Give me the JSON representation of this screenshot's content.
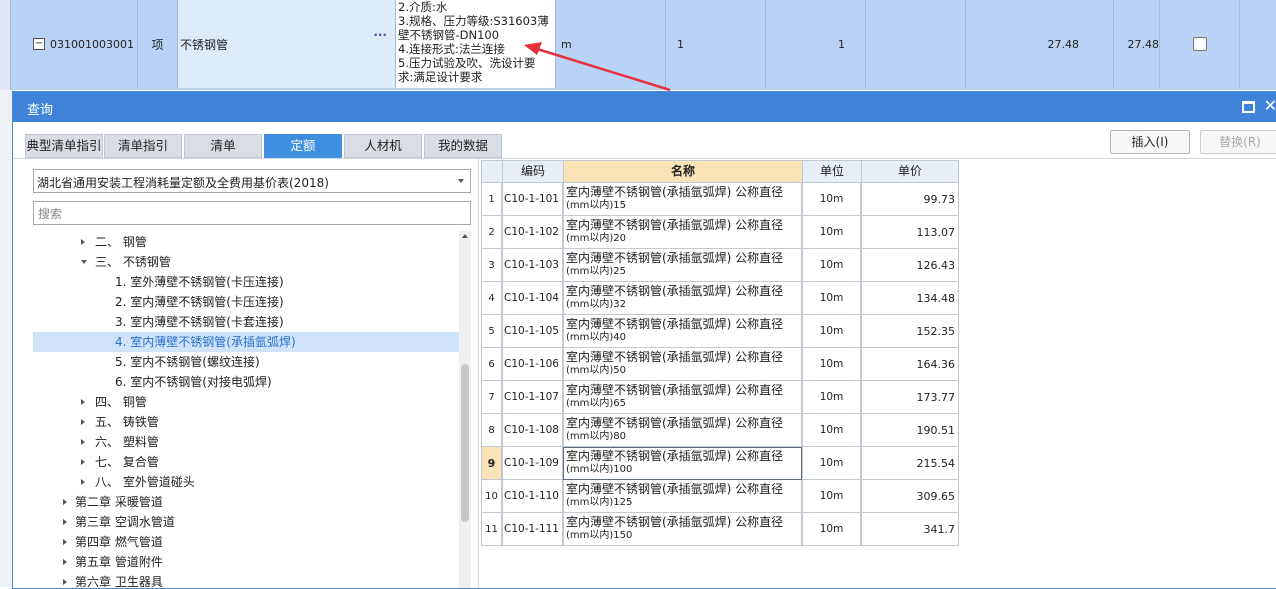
{
  "bg_row": {
    "expander": "−",
    "code": "031001003001",
    "type": "项",
    "name": "不锈钢管",
    "dots": "···",
    "desc_lines": [
      "2.介质:水",
      "3.规格、压力等级:S31603薄",
      "壁不锈钢管-DN100",
      "4.连接形式:法兰连接",
      "5.压力试验及吹、洗设计要",
      "求:满足设计要求"
    ],
    "unit": "m",
    "qty1": "1",
    "qty2": "1",
    "price1": "27.48",
    "price2": "27.48"
  },
  "dialog": {
    "title": "查询",
    "tabs": [
      "典型清单指引",
      "清单指引",
      "清单",
      "定额",
      "人材机",
      "我的数据"
    ],
    "active_tab": "定额",
    "insert_label": "插入(I)",
    "replace_label": "替换(R)",
    "library": "湖北省通用安装工程消耗量定额及全费用基价表(2018)",
    "search_placeholder": "搜索",
    "tree": [
      {
        "label": "二、 钢管",
        "level": 1,
        "expand": "collapsed"
      },
      {
        "label": "三、 不锈钢管",
        "level": 1,
        "expand": "expanded"
      },
      {
        "label": "1. 室外薄壁不锈钢管(卡压连接)",
        "level": 2,
        "expand": "none"
      },
      {
        "label": "2. 室内薄壁不锈钢管(卡压连接)",
        "level": 2,
        "expand": "none"
      },
      {
        "label": "3. 室内薄壁不锈钢管(卡套连接)",
        "level": 2,
        "expand": "none"
      },
      {
        "label": "4. 室内薄壁不锈钢管(承插氩弧焊)",
        "level": 2,
        "expand": "none",
        "selected": true
      },
      {
        "label": "5. 室内不锈钢管(螺纹连接)",
        "level": 2,
        "expand": "none"
      },
      {
        "label": "6. 室内不锈钢管(对接电弧焊)",
        "level": 2,
        "expand": "none"
      },
      {
        "label": "四、 铜管",
        "level": 1,
        "expand": "collapsed"
      },
      {
        "label": "五、 铸铁管",
        "level": 1,
        "expand": "collapsed"
      },
      {
        "label": "六、 塑料管",
        "level": 1,
        "expand": "collapsed"
      },
      {
        "label": "七、 复合管",
        "level": 1,
        "expand": "collapsed"
      },
      {
        "label": "八、 室外管道碰头",
        "level": 1,
        "expand": "collapsed"
      },
      {
        "label": "第二章 采暖管道",
        "level": 0,
        "expand": "collapsed"
      },
      {
        "label": "第三章 空调水管道",
        "level": 0,
        "expand": "collapsed"
      },
      {
        "label": "第四章 燃气管道",
        "level": 0,
        "expand": "collapsed"
      },
      {
        "label": "第五章 管道附件",
        "level": 0,
        "expand": "collapsed"
      },
      {
        "label": "第六章 卫生器具",
        "level": 0,
        "expand": "collapsed"
      }
    ],
    "table": {
      "headers": {
        "index": "",
        "code": "编码",
        "name": "名称",
        "unit": "单位",
        "price": "单价"
      },
      "current_row": 9,
      "rows": [
        {
          "index": "1",
          "code": "C10-1-101",
          "name1": "室内薄壁不锈钢管(承插氩弧焊) 公称直径",
          "name2": "(mm以内)15",
          "unit": "10m",
          "price": "99.73"
        },
        {
          "index": "2",
          "code": "C10-1-102",
          "name1": "室内薄壁不锈钢管(承插氩弧焊) 公称直径",
          "name2": "(mm以内)20",
          "unit": "10m",
          "price": "113.07"
        },
        {
          "index": "3",
          "code": "C10-1-103",
          "name1": "室内薄壁不锈钢管(承插氩弧焊) 公称直径",
          "name2": "(mm以内)25",
          "unit": "10m",
          "price": "126.43"
        },
        {
          "index": "4",
          "code": "C10-1-104",
          "name1": "室内薄壁不锈钢管(承插氩弧焊) 公称直径",
          "name2": "(mm以内)32",
          "unit": "10m",
          "price": "134.48"
        },
        {
          "index": "5",
          "code": "C10-1-105",
          "name1": "室内薄壁不锈钢管(承插氩弧焊) 公称直径",
          "name2": "(mm以内)40",
          "unit": "10m",
          "price": "152.35"
        },
        {
          "index": "6",
          "code": "C10-1-106",
          "name1": "室内薄壁不锈钢管(承插氩弧焊) 公称直径",
          "name2": "(mm以内)50",
          "unit": "10m",
          "price": "164.36"
        },
        {
          "index": "7",
          "code": "C10-1-107",
          "name1": "室内薄壁不锈钢管(承插氩弧焊) 公称直径",
          "name2": "(mm以内)65",
          "unit": "10m",
          "price": "173.77"
        },
        {
          "index": "8",
          "code": "C10-1-108",
          "name1": "室内薄壁不锈钢管(承插氩弧焊) 公称直径",
          "name2": "(mm以内)80",
          "unit": "10m",
          "price": "190.51"
        },
        {
          "index": "9",
          "code": "C10-1-109",
          "name1": "室内薄壁不锈钢管(承插氩弧焊) 公称直径",
          "name2": "(mm以内)100",
          "unit": "10m",
          "price": "215.54"
        },
        {
          "index": "10",
          "code": "C10-1-110",
          "name1": "室内薄壁不锈钢管(承插氩弧焊) 公称直径",
          "name2": "(mm以内)125",
          "unit": "10m",
          "price": "309.65"
        },
        {
          "index": "11",
          "code": "C10-1-111",
          "name1": "室内薄壁不锈钢管(承插氩弧焊) 公称直径",
          "name2": "(mm以内)150",
          "unit": "10m",
          "price": "341.7"
        }
      ]
    }
  },
  "colors": {
    "titlebar": "#3f84d8",
    "active_tab": "#3f8fe0",
    "selection": "#b8d3f5",
    "name_header": "#fbe3b8",
    "arrow": "#e8303a"
  },
  "icons": {
    "expander": "minus-box-icon",
    "maximize": "maximize-icon",
    "close": "close-icon",
    "tree_expand": "triangle-right-icon",
    "tree_collapse": "triangle-down-icon",
    "annotation": "red-arrow-icon"
  }
}
